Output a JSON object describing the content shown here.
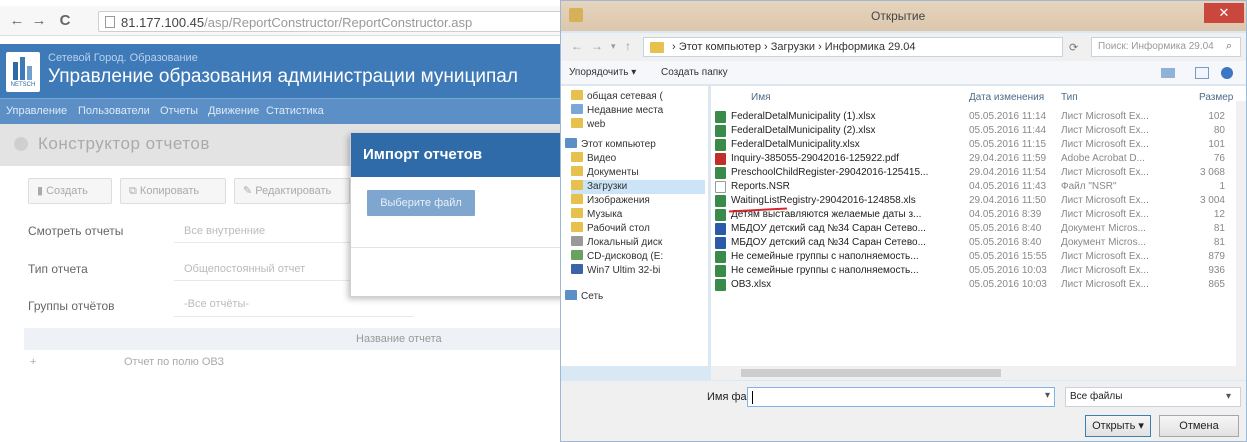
{
  "browser": {
    "url_host": "81.177.100.45",
    "url_path": "/asp/ReportConstructor/ReportConstructor.asp",
    "portal": {
      "subtitle": "Сетевой Город. Образование",
      "title": "Управление образования администрации муниципал",
      "logo_text": "NETSCH"
    },
    "menu": [
      "Управление",
      "Пользователи",
      "Отчеты",
      "Движение",
      "Статистика"
    ],
    "page_title": "Конструктор отчетов",
    "toolbar": [
      "Создать",
      "Копировать",
      "Редактировать"
    ],
    "form": {
      "view_label": "Смотреть отчеты",
      "view_value": "Все внутренние",
      "type_label": "Тип отчета",
      "type_value": "Общепостоянный отчет",
      "group_label": "Группы отчётов",
      "group_value": "-Все отчёты-"
    },
    "grid": {
      "header": "Название отчета",
      "rows": [
        {
          "plus": "+",
          "name": "Отчет по полю ОВЗ"
        }
      ]
    },
    "modal": {
      "title": "Импорт отчетов",
      "choose_button": "Выберите файл"
    }
  },
  "dialog": {
    "title": "Открытие",
    "close": "✕",
    "breadcrumb": "›  Этот компьютер  ›  Загрузки  ›  Информика 29.04",
    "search_placeholder": "Поиск: Информика 29.04",
    "commands": {
      "organize": "Упорядочить ▾",
      "new_folder": "Создать папку"
    },
    "nav": [
      {
        "label": "общая сетевая (",
        "color": "#e6c14e"
      },
      {
        "label": "Недавние места",
        "color": "#7ba7d6"
      },
      {
        "label": "web",
        "color": "#e6c14e"
      },
      {
        "label": "Этот компьютер",
        "color": "#5b8fc6"
      },
      {
        "label": "Видео",
        "color": "#e6c14e"
      },
      {
        "label": "Документы",
        "color": "#e6c14e"
      },
      {
        "label": "Загрузки",
        "color": "#e6c14e",
        "selected": true
      },
      {
        "label": "Изображения",
        "color": "#e6c14e"
      },
      {
        "label": "Музыка",
        "color": "#e6c14e"
      },
      {
        "label": "Рабочий стол",
        "color": "#e6c14e"
      },
      {
        "label": "Локальный диск",
        "color": "#999999"
      },
      {
        "label": "CD-дисковод (E:",
        "color": "#6aa060"
      },
      {
        "label": "Win7 Ultim 32-bi",
        "color": "#3b63a8"
      },
      {
        "label": "Сеть",
        "color": "#5b8fc6"
      }
    ],
    "columns": [
      "Имя",
      "Дата изменения",
      "Тип",
      "Размер"
    ],
    "files": [
      {
        "name": "FederalDetalMunicipality (1).xlsx",
        "date": "05.05.2016 11:14",
        "type": "Лист Microsoft Ex...",
        "size": "102",
        "color": "#3a8a4a"
      },
      {
        "name": "FederalDetalMunicipality (2).xlsx",
        "date": "05.05.2016 11:44",
        "type": "Лист Microsoft Ex...",
        "size": "80",
        "color": "#3a8a4a"
      },
      {
        "name": "FederalDetalMunicipality.xlsx",
        "date": "05.05.2016 11:15",
        "type": "Лист Microsoft Ex...",
        "size": "101",
        "color": "#3a8a4a"
      },
      {
        "name": "Inquiry-385055-29042016-125922.pdf",
        "date": "29.04.2016 11:59",
        "type": "Adobe Acrobat D...",
        "size": "76",
        "color": "#c0302a"
      },
      {
        "name": "PreschoolChildRegister-29042016-125415...",
        "date": "29.04.2016 11:54",
        "type": "Лист Microsoft Ex...",
        "size": "3 068",
        "color": "#3a8a4a"
      },
      {
        "name": "Reports.NSR",
        "date": "04.05.2016 11:43",
        "type": "Файл \"NSR\"",
        "size": "1",
        "color": "#ffffff"
      },
      {
        "name": "WaitingListRegistry-29042016-124858.xls",
        "date": "29.04.2016 11:50",
        "type": "Лист Microsoft Ex...",
        "size": "3 004",
        "color": "#3a8a4a"
      },
      {
        "name": "Детям выставляются желаемые даты з...",
        "date": "04.05.2016 8:39",
        "type": "Лист Microsoft Ex...",
        "size": "12",
        "color": "#3a8a4a"
      },
      {
        "name": "МБДОУ детский сад №34 Саран Сетево...",
        "date": "05.05.2016 8:40",
        "type": "Документ Micros...",
        "size": "81",
        "color": "#2a5aa8"
      },
      {
        "name": "МБДОУ детский сад №34 Саран Сетево...",
        "date": "05.05.2016 8:40",
        "type": "Документ Micros...",
        "size": "81",
        "color": "#2a5aa8"
      },
      {
        "name": "Не семейные группы с наполняемость...",
        "date": "05.05.2016 15:55",
        "type": "Лист Microsoft Ex...",
        "size": "879",
        "color": "#3a8a4a"
      },
      {
        "name": "Не семейные группы с наполняемость...",
        "date": "05.05.2016 10:03",
        "type": "Лист Microsoft Ex...",
        "size": "936",
        "color": "#3a8a4a"
      },
      {
        "name": "ОВЗ.xlsx",
        "date": "05.05.2016 10:03",
        "type": "Лист Microsoft Ex...",
        "size": "865",
        "color": "#3a8a4a"
      }
    ],
    "filename_label": "Имя файла:",
    "filetype_value": "Все файлы",
    "open_button": "Открыть",
    "cancel_button": "Отмена"
  }
}
